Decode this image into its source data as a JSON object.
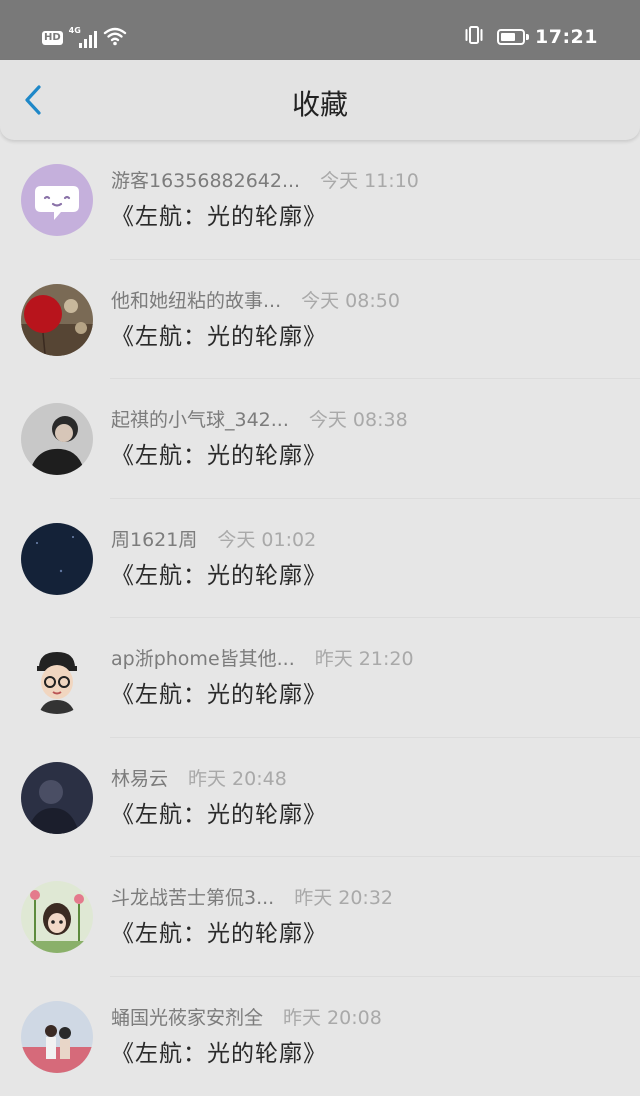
{
  "status_bar": {
    "hd": "HD",
    "network": "4G",
    "time": "17:21",
    "battery_level_percent": 70,
    "icons": [
      "hd-icon",
      "cellular-signal-icon",
      "wifi-icon",
      "vibrate-icon",
      "battery-icon"
    ]
  },
  "nav": {
    "back_icon": "chevron-left-icon",
    "title": "收藏",
    "accent": "#1f88c8"
  },
  "items": [
    {
      "name": "游客16356882642...",
      "time": "今天 11:10",
      "title": "《左航：光的轮廓》",
      "avatar": "chat-bubble"
    },
    {
      "name": "他和她纽粘的故事...",
      "time": "今天 08:50",
      "title": "《左航：光的轮廓》",
      "avatar": "red-balloon"
    },
    {
      "name": "起祺的小气球_342...",
      "time": "今天 08:38",
      "title": "《左航：光的轮廓》",
      "avatar": "person-photo"
    },
    {
      "name": "周1621周",
      "time": "今天 01:02",
      "title": "《左航：光的轮廓》",
      "avatar": "night-sky"
    },
    {
      "name": "ap浙phome皆其他...",
      "time": "昨天 21:20",
      "title": "《左航：光的轮廓》",
      "avatar": "cartoon-boy"
    },
    {
      "name": "林易云",
      "time": "昨天 20:48",
      "title": "《左航：光的轮廓》",
      "avatar": "dark-portrait"
    },
    {
      "name": "斗龙战苦士第侃3...",
      "time": "昨天 20:32",
      "title": "《左航：光的轮廓》",
      "avatar": "cartoon-girl-flowers"
    },
    {
      "name": "蛹国光莜家安剂全",
      "time": "昨天 20:08",
      "title": "《左航：光的轮廓》",
      "avatar": "couple-photo"
    }
  ]
}
